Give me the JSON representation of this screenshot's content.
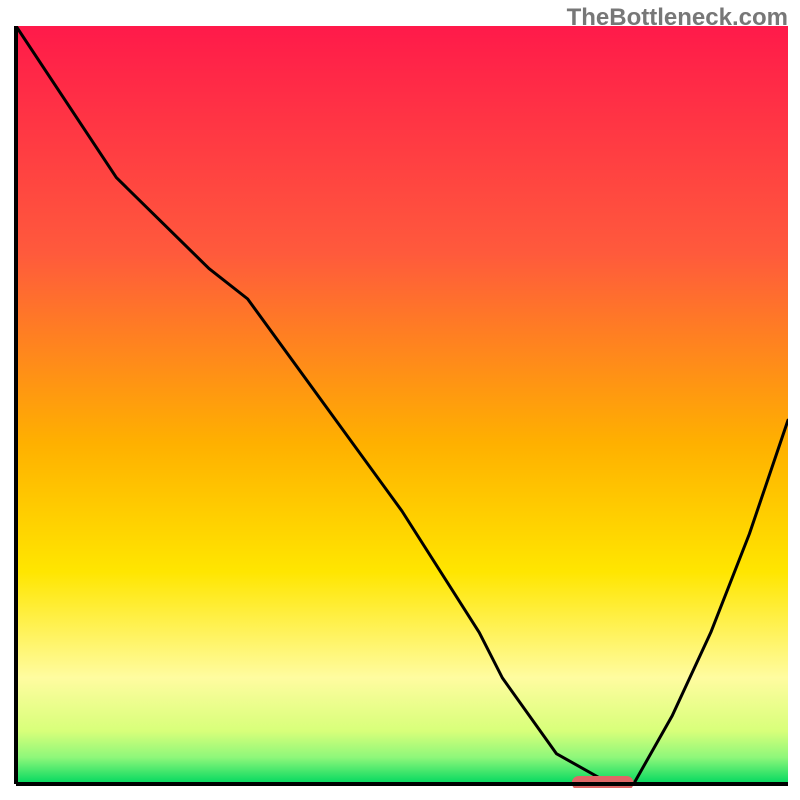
{
  "watermark": "TheBottleneck.com",
  "chart_data": {
    "type": "line",
    "title": "",
    "xlabel": "",
    "ylabel": "",
    "xlim": [
      0,
      100
    ],
    "ylim": [
      0,
      100
    ],
    "series": [
      {
        "name": "curve",
        "x": [
          0,
          13,
          25,
          30,
          40,
          50,
          60,
          63,
          70,
          77,
          80,
          85,
          90,
          95,
          100
        ],
        "values": [
          100,
          80,
          68,
          64,
          50,
          36,
          20,
          14,
          4,
          0,
          0,
          9,
          20,
          33,
          48
        ]
      }
    ],
    "marker": {
      "x_start": 72,
      "x_end": 80,
      "y": 0,
      "color": "#e06666"
    },
    "gradient_stops": [
      {
        "offset": 0.0,
        "color": "#ff1a4a"
      },
      {
        "offset": 0.3,
        "color": "#ff5a3c"
      },
      {
        "offset": 0.55,
        "color": "#ffb000"
      },
      {
        "offset": 0.72,
        "color": "#ffe600"
      },
      {
        "offset": 0.86,
        "color": "#fffca0"
      },
      {
        "offset": 0.93,
        "color": "#d8ff7a"
      },
      {
        "offset": 0.965,
        "color": "#8ef77a"
      },
      {
        "offset": 1.0,
        "color": "#00d860"
      }
    ],
    "axis_color": "#000000",
    "line_color": "#000000"
  }
}
